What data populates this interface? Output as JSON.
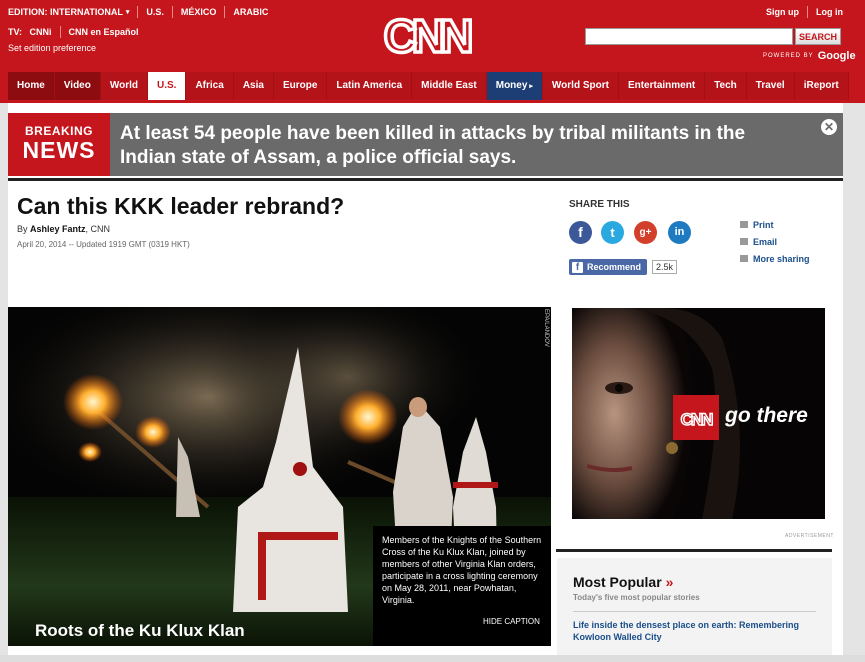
{
  "header": {
    "edition_label": "EDITION:",
    "edition_value": "INTERNATIONAL",
    "edition_links": [
      "U.S.",
      "MÉXICO",
      "ARABIC"
    ],
    "tv_label": "TV:",
    "tv_links": [
      "CNNi",
      "CNN en Español"
    ],
    "set_pref": "Set edition preference",
    "logo_text": "CNN",
    "sign_up": "Sign up",
    "log_in": "Log in",
    "search_button": "SEARCH",
    "search_value": "",
    "powered_by": "POWERED BY",
    "google": "Google"
  },
  "nav": {
    "items": [
      "Home",
      "Video",
      "World",
      "U.S.",
      "Africa",
      "Asia",
      "Europe",
      "Latin America",
      "Middle East",
      "Money",
      "World Sport",
      "Entertainment",
      "Tech",
      "Travel",
      "iReport"
    ],
    "active": "U.S."
  },
  "breaking": {
    "badge_top": "BREAKING",
    "badge_bottom": "NEWS",
    "text": "At least 54 people have been killed in attacks by tribal militants in the Indian state of Assam, a police official says."
  },
  "article": {
    "headline": "Can this KKK leader rebrand?",
    "by": "By",
    "author": "Ashley Fantz",
    "outlet": ", CNN",
    "date": "April 20, 2014 -- Updated 1919 GMT (0319 HKT)"
  },
  "share": {
    "title": "SHARE THIS",
    "recommend": "Recommend",
    "recommend_count": "2.5k",
    "print": "Print",
    "email": "Email",
    "more": "More sharing"
  },
  "photo": {
    "caption": "Members of the Knights of the Southern Cross of the Ku Klux Klan, joined by members of other Virginia Klan orders, participate in a cross lighting ceremony on May 28, 2011, near Powhatan, Virginia.",
    "hide_caption": "HIDE CAPTION",
    "title": "Roots of the Ku Klux Klan",
    "credit": "EPA/LANDOV"
  },
  "ad": {
    "logo": "CNN",
    "tagline": "go there",
    "label": "ADVERTISEMENT"
  },
  "most_popular": {
    "title": "Most Popular",
    "arrow": "»",
    "subtitle": "Today's five most popular stories",
    "first_item": "Life inside the densest place on earth: Remembering Kowloon Walled City"
  },
  "colors": {
    "cnn_red": "#c4161c",
    "money_blue": "#1d3e75",
    "breaking_gray": "#6a6a6a",
    "link_blue": "#1a4e8a"
  }
}
